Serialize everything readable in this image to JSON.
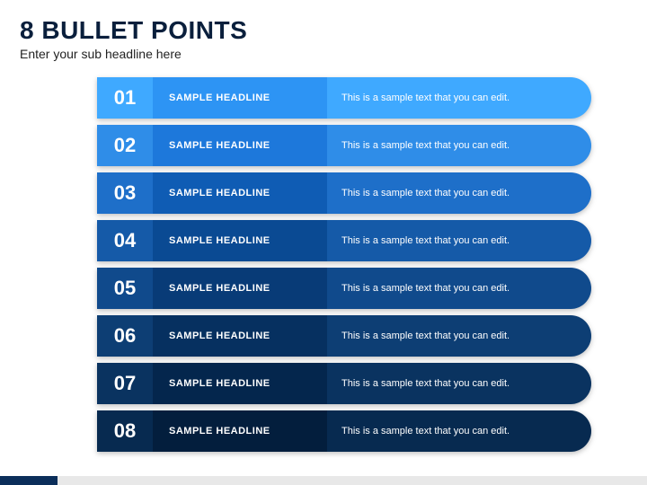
{
  "title": "8 BULLET POINTS",
  "subtitle": "Enter your sub headline here",
  "rows": [
    {
      "num": "01",
      "headline": "SAMPLE HEADLINE",
      "desc": "This is a sample text that you can edit.",
      "numBg": "#3fa9ff",
      "hdBg": "#2d94f4",
      "descBg": "#3fa9ff"
    },
    {
      "num": "02",
      "headline": "SAMPLE HEADLINE",
      "desc": "This is a sample text that you can edit.",
      "numBg": "#2f8de8",
      "hdBg": "#1d78db",
      "descBg": "#2f8de8"
    },
    {
      "num": "03",
      "headline": "SAMPLE HEADLINE",
      "desc": "This is a sample text that you can edit.",
      "numBg": "#1e6fc9",
      "hdBg": "#0f5cb4",
      "descBg": "#1e6fc9"
    },
    {
      "num": "04",
      "headline": "SAMPLE HEADLINE",
      "desc": "This is a sample text that you can edit.",
      "numBg": "#155aa8",
      "hdBg": "#0a4a93",
      "descBg": "#155aa8"
    },
    {
      "num": "05",
      "headline": "SAMPLE HEADLINE",
      "desc": "This is a sample text that you can edit.",
      "numBg": "#104a8c",
      "hdBg": "#083b77",
      "descBg": "#104a8c"
    },
    {
      "num": "06",
      "headline": "SAMPLE HEADLINE",
      "desc": "This is a sample text that you can edit.",
      "numBg": "#0d3e74",
      "hdBg": "#063060",
      "descBg": "#0d3e74"
    },
    {
      "num": "07",
      "headline": "SAMPLE HEADLINE",
      "desc": "This is a sample text that you can edit.",
      "numBg": "#0a3360",
      "hdBg": "#04264d",
      "descBg": "#0a3360"
    },
    {
      "num": "08",
      "headline": "SAMPLE HEADLINE",
      "desc": "This is a sample text that you can edit.",
      "numBg": "#072a50",
      "hdBg": "#031e3d",
      "descBg": "#072a50"
    }
  ]
}
